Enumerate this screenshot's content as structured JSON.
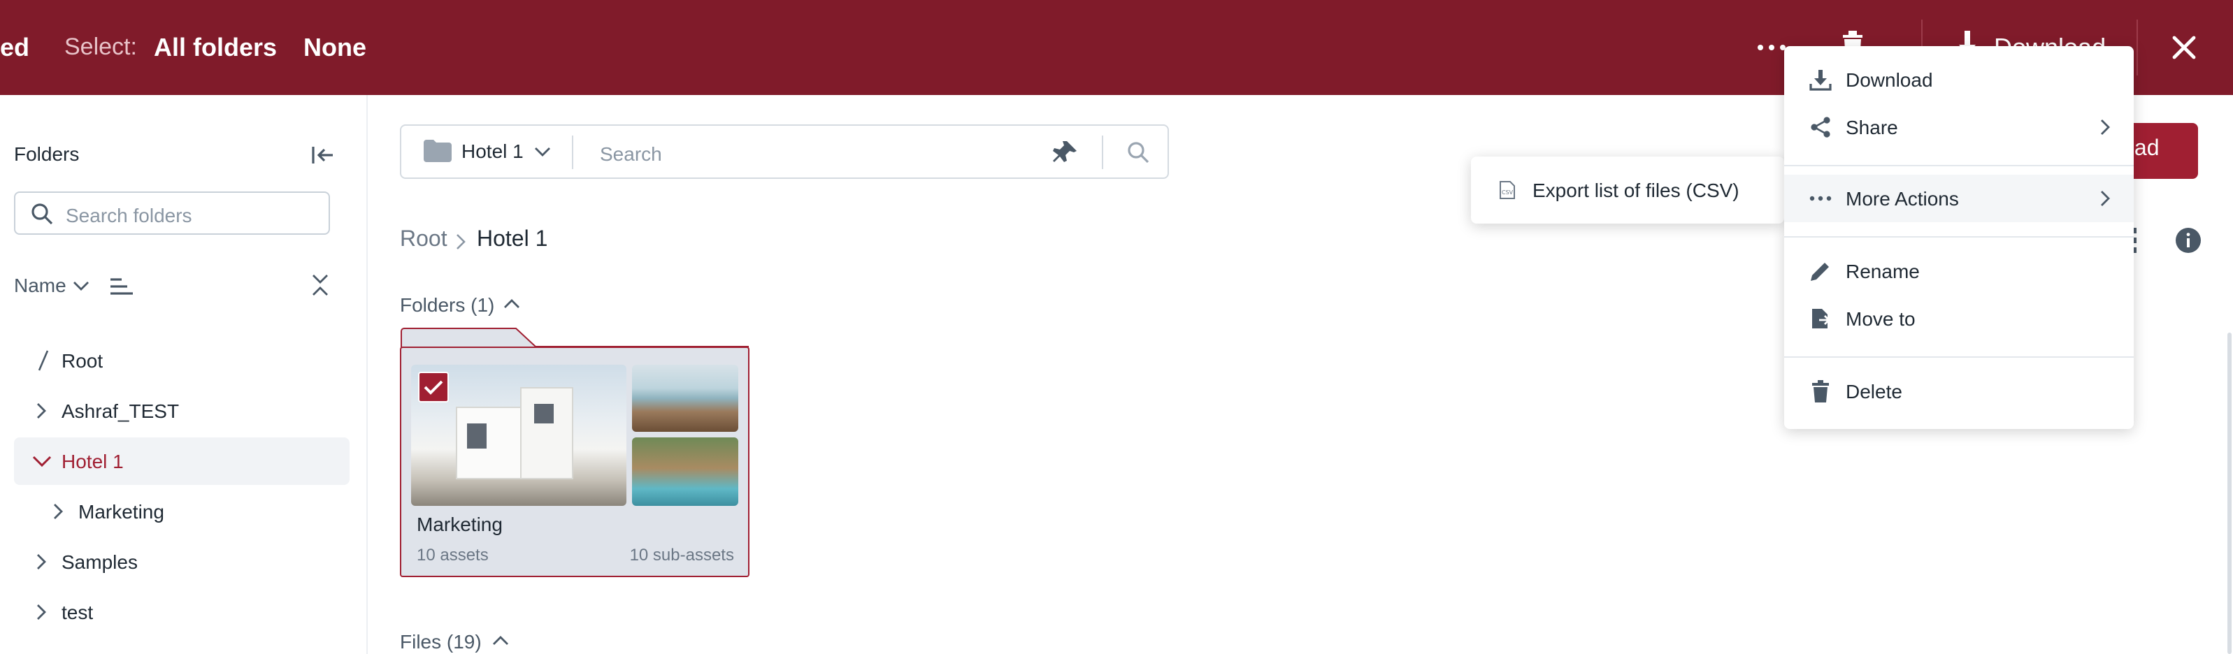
{
  "colors": {
    "brand": "#801b2a",
    "accent": "#a01f32",
    "selected_row": "#f1f3f6"
  },
  "topbar": {
    "left_fragment": "ed",
    "select_label": "Select:",
    "all_folders": "All folders",
    "none": "None",
    "download_label": "Download",
    "icons": [
      "more-icon",
      "trash-icon",
      "download-icon",
      "close-icon"
    ]
  },
  "sidebar": {
    "title": "Folders",
    "search_placeholder": "Search folders",
    "sort_label": "Name",
    "tree": [
      {
        "label": "Root",
        "level": 0,
        "state": "root"
      },
      {
        "label": "Ashraf_TEST",
        "level": 0,
        "state": "collapsed"
      },
      {
        "label": "Hotel 1",
        "level": 0,
        "state": "expanded",
        "selected": true
      },
      {
        "label": "Marketing",
        "level": 1,
        "state": "collapsed"
      },
      {
        "label": "Samples",
        "level": 0,
        "state": "collapsed"
      },
      {
        "label": "test",
        "level": 0,
        "state": "collapsed"
      }
    ]
  },
  "main": {
    "folder_scope": "Hotel 1",
    "search_placeholder": "Search",
    "breadcrumb": [
      "Root",
      "Hotel 1"
    ],
    "folders_section": "Folders (1)",
    "files_section": "Files (19)",
    "upload_fragment": "load",
    "folder_card": {
      "name": "Marketing",
      "assets": "10 assets",
      "sub_assets": "10 sub-assets",
      "checked": true
    }
  },
  "context_menu": {
    "items": [
      "Download",
      "Share",
      "More Actions",
      "Rename",
      "Move to",
      "Delete"
    ]
  },
  "submenu": {
    "items": [
      "Export list of files (CSV)"
    ]
  }
}
